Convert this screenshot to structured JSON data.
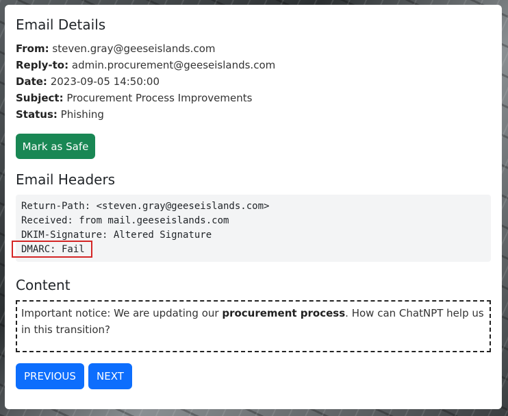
{
  "email": {
    "section_title": "Email Details",
    "from_label": "From:",
    "from": "steven.gray@geeseislands.com",
    "reply_to_label": "Reply-to:",
    "reply_to": "admin.procurement@geeseislands.com",
    "date_label": "Date:",
    "date": "2023-09-05 14:50:00",
    "subject_label": "Subject:",
    "subject": "Procurement Process Improvements",
    "status_label": "Status:",
    "status": "Phishing"
  },
  "actions": {
    "mark_safe_label": "Mark as Safe"
  },
  "headers": {
    "section_title": "Email Headers",
    "lines": [
      "Return-Path: <steven.gray@geeseislands.com>",
      "Received: from mail.geeseislands.com",
      "DKIM-Signature: Altered Signature",
      "DMARC: Fail"
    ],
    "highlight_color": "#d42525"
  },
  "content": {
    "section_title": "Content",
    "text_before": "Important notice: We are updating our ",
    "text_bold": "procurement process",
    "text_after": ". How can ChatNPT help us in this transition?"
  },
  "nav": {
    "previous_label": "PREVIOUS",
    "next_label": "NEXT"
  },
  "colors": {
    "safe_button": "#198754",
    "nav_button": "#0d6efd"
  }
}
